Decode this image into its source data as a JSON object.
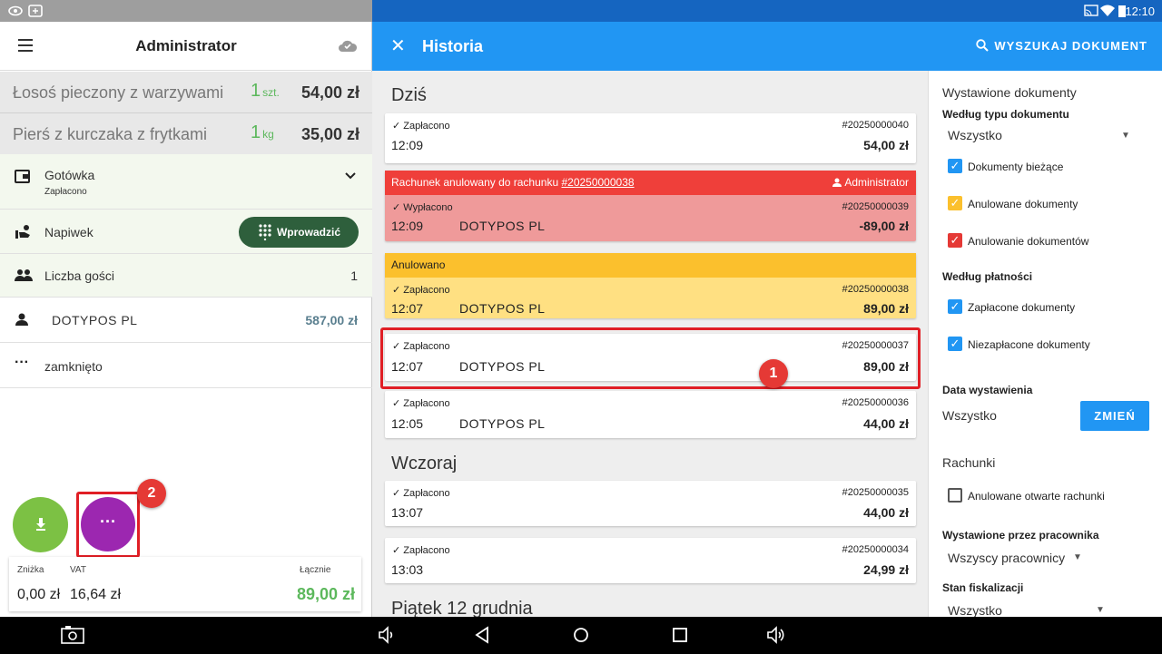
{
  "status_bar": {
    "time": "12:10",
    "icons": [
      "eye-icon",
      "remote-icon",
      "cast-icon",
      "wifi-icon",
      "battery-icon"
    ]
  },
  "left": {
    "title": "Administrator",
    "items": [
      {
        "name": "Łosoś pieczony z warzywami",
        "qty": "1",
        "unit": "szt.",
        "price": "54,00 zł"
      },
      {
        "name": "Pierś z kurczaka z frytkami",
        "qty": "1",
        "unit": "kg",
        "price": "35,00 zł"
      }
    ],
    "payment": {
      "label": "Gotówka",
      "status": "Zapłacono"
    },
    "tip": {
      "label": "Napiwek",
      "button": "Wprowadzić"
    },
    "guests": {
      "label": "Liczba gości",
      "value": "1"
    },
    "customer": {
      "name": "DOTYPOS  PL",
      "amount": "587,00 zł"
    },
    "more": {
      "label": "zamknięto"
    },
    "fab_more": "···",
    "badge": "2",
    "summary": {
      "discount_label": "Zniżka",
      "discount": "0,00 zł",
      "vat_label": "VAT",
      "vat": "16,64 zł",
      "total_label": "Łącznie",
      "total": "89,00 zł"
    }
  },
  "history": {
    "title": "Historia",
    "search": "WYSZUKAJ DOKUMENT",
    "days": {
      "today": "Dziś",
      "yesterday": "Wczoraj",
      "friday": "Piątek 12 grudnia"
    },
    "cards": [
      {
        "status": "Zapłacono",
        "number": "#20250000040",
        "time": "12:09",
        "name": "",
        "amount": "54,00 zł"
      },
      {
        "banner_text": "Rachunek anulowany do rachunku ",
        "banner_link": "#20250000038",
        "banner_user": "Administrator",
        "status": "Wypłacono",
        "number": "#20250000039",
        "time": "12:09",
        "name": "DOTYPOS  PL",
        "amount": "-89,00 zł"
      },
      {
        "banner_text": "Anulowano",
        "status": "Zapłacono",
        "number": "#20250000038",
        "time": "12:07",
        "name": "DOTYPOS  PL",
        "amount": "89,00 zł"
      },
      {
        "status": "Zapłacono",
        "number": "#20250000037",
        "time": "12:07",
        "name": "DOTYPOS  PL",
        "amount": "89,00 zł"
      },
      {
        "status": "Zapłacono",
        "number": "#20250000036",
        "time": "12:05",
        "name": "DOTYPOS  PL",
        "amount": "44,00 zł"
      },
      {
        "status": "Zapłacono",
        "number": "#20250000035",
        "time": "13:07",
        "name": "",
        "amount": "44,00 zł"
      },
      {
        "status": "Zapłacono",
        "number": "#20250000034",
        "time": "13:03",
        "name": "",
        "amount": "24,99 zł"
      }
    ],
    "badge": "1"
  },
  "filters": {
    "title": "Wystawione dokumenty",
    "by_type": "Według typu dokumentu",
    "type_value": "Wszystko",
    "cb_current": "Dokumenty bieżące",
    "cb_cancelled": "Anulowane dokumenty",
    "cb_cancelling": "Anulowanie dokumentów",
    "by_payment": "Według płatności",
    "cb_paid": "Zapłacone dokumenty",
    "cb_unpaid": "Niezapłacone dokumenty",
    "date_label": "Data wystawienia",
    "date_value": "Wszystko",
    "change_btn": "ZMIEŃ",
    "bills": "Rachunki",
    "cb_open": "Anulowane otwarte rachunki",
    "by_employee": "Wystawione przez pracownika",
    "employee_value": "Wszyscy pracownicy",
    "fiscal": "Stan fiskalizacji",
    "fiscal_value": "Wszystko",
    "colors": {
      "blue": "#2196f3",
      "yellow": "#fbc02d",
      "red": "#e53935"
    }
  }
}
